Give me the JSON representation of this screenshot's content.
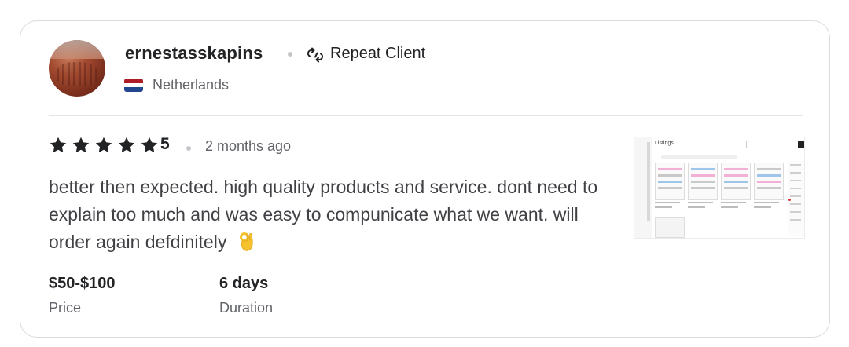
{
  "reviewer": {
    "username": "ernestasskapins",
    "badge_label": "Repeat Client",
    "badge_icon": "repeat-icon",
    "country": "Netherlands",
    "flag_colors": [
      "#AE1C28",
      "#FFFFFF",
      "#21468B"
    ]
  },
  "review": {
    "stars": 5,
    "rating_text": "5",
    "time_ago": "2 months ago",
    "text": "better then expected. high quality products and service. dont need to explain too much and was easy to compunicate what we want. will order again defdinitely",
    "emoji": "ok-hand-emoji"
  },
  "meta": {
    "price_value": "$50-$100",
    "price_label": "Price",
    "duration_value": "6 days",
    "duration_label": "Duration"
  },
  "thumbnail": {
    "title": "Listings"
  },
  "colors": {
    "star": "#222325",
    "text_primary": "#222325",
    "text_secondary": "#62646a",
    "divider": "#e4e5e7"
  }
}
